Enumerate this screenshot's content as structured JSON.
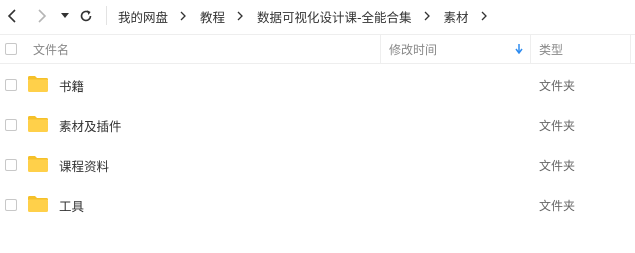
{
  "nav": {
    "back_icon": "chevron-left-icon",
    "forward_icon": "chevron-right-icon",
    "history_icon": "caret-down-icon",
    "refresh_icon": "refresh-icon"
  },
  "breadcrumb": [
    "我的网盘",
    "教程",
    "数据可视化设计课-全能合集",
    "素材"
  ],
  "columns": {
    "name": "文件名",
    "modified": "修改时间",
    "type": "类型",
    "sort_indicator": "arrow-down-icon"
  },
  "colors": {
    "folder": "#ffd04a",
    "folder_tab": "#f5c029",
    "sort_arrow": "#2e8cf0"
  },
  "files": [
    {
      "name": "书籍",
      "modified": "",
      "type": "文件夹"
    },
    {
      "name": "素材及插件",
      "modified": "",
      "type": "文件夹"
    },
    {
      "name": "课程资料",
      "modified": "",
      "type": "文件夹"
    },
    {
      "name": "工具",
      "modified": "",
      "type": "文件夹"
    }
  ]
}
